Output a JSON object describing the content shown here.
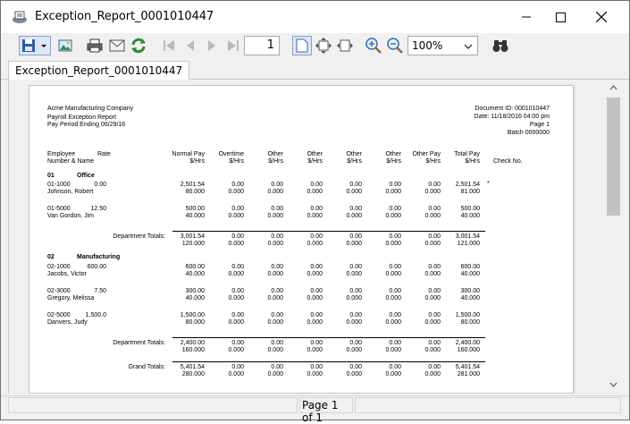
{
  "window": {
    "title": "Exception_Report_0001010447"
  },
  "toolbar": {
    "page_number": "1",
    "zoom": "100%"
  },
  "tab": {
    "label": "Exception_Report_0001010447"
  },
  "status": {
    "page_text": "Page 1 of 1"
  },
  "report": {
    "company": "Acme Manufacturing Company",
    "report_name": "Payroll Exception Report",
    "period": "Pay Period Ending 06/29/16",
    "document_id": "Document ID: 0001010447",
    "date": "Date: 11/18/2016  04:00 pm",
    "page": "Page 1",
    "batch": "Batch 0000000",
    "headers": {
      "employee": "Employee",
      "number_name": "Number & Name",
      "rate": "Rate",
      "normal_pay": "Normal Pay",
      "overtime": "Overtime",
      "other1": "Other",
      "other2": "Other",
      "other3": "Other",
      "other4": "Other",
      "other_pay": "Other Pay",
      "total_pay": "Total Pay",
      "hrs1": "$/Hrs",
      "hrs2": "$/Hrs",
      "hrs3": "$/Hrs",
      "hrs4": "$/Hrs",
      "hrs5": "$/Hrs",
      "hrs6": "$/Hrs",
      "hrs7": "$/Hrs",
      "hrs8": "$/Hrs",
      "check_no": "Check No."
    },
    "dept1": {
      "number": "01",
      "name": "Office"
    },
    "dept2": {
      "number": "02",
      "name": "Manufacturing"
    },
    "emp1": {
      "id": "01-1000",
      "rate": "0.00",
      "name": "Johnson, Robert",
      "v1": [
        "2,501.54",
        "0.00",
        "0.00",
        "0.00",
        "0.00",
        "0.00",
        "0.00",
        "2,501.54"
      ],
      "v2": [
        "80.000",
        "0.000",
        "0.000",
        "0.000",
        "0.000",
        "0.000",
        "0.000",
        "81.000"
      ],
      "flag": "*"
    },
    "emp2": {
      "id": "01-5000",
      "rate": "12.50",
      "name": "Van Gordon, Jim",
      "v1": [
        "500.00",
        "0.00",
        "0.00",
        "0.00",
        "0.00",
        "0.00",
        "0.00",
        "500.00"
      ],
      "v2": [
        "40.000",
        "0.000",
        "0.000",
        "0.000",
        "0.000",
        "0.000",
        "0.000",
        "40.000"
      ]
    },
    "dept1_totals": {
      "label": "Department Totals:",
      "v1": [
        "3,001.54",
        "0.00",
        "0.00",
        "0.00",
        "0.00",
        "0.00",
        "0.00",
        "3,001.54"
      ],
      "v2": [
        "120.000",
        "0.000",
        "0.000",
        "0.000",
        "0.000",
        "0.000",
        "0.000",
        "121.000"
      ]
    },
    "emp3": {
      "id": "02-1000",
      "rate": "600.00",
      "name": "Jacobs, Victor",
      "v1": [
        "600.00",
        "0.00",
        "0.00",
        "0.00",
        "0.00",
        "0.00",
        "0.00",
        "600.00"
      ],
      "v2": [
        "40.000",
        "0.000",
        "0.000",
        "0.000",
        "0.000",
        "0.000",
        "0.000",
        "40.000"
      ]
    },
    "emp4": {
      "id": "02-3000",
      "rate": "7.50",
      "name": "Gregory, Melissa",
      "v1": [
        "300.00",
        "0.00",
        "0.00",
        "0.00",
        "0.00",
        "0.00",
        "0.00",
        "300.00"
      ],
      "v2": [
        "40.000",
        "0.000",
        "0.000",
        "0.000",
        "0.000",
        "0.000",
        "0.000",
        "40.000"
      ]
    },
    "emp5": {
      "id": "02-5000",
      "rate": "1,500.0",
      "name": "Danvers, Judy",
      "v1": [
        "1,500.00",
        "0.00",
        "0.00",
        "0.00",
        "0.00",
        "0.00",
        "0.00",
        "1,500.00"
      ],
      "v2": [
        "80.000",
        "0.000",
        "0.000",
        "0.000",
        "0.000",
        "0.000",
        "0.000",
        "80.000"
      ]
    },
    "dept2_totals": {
      "label": "Department Totals:",
      "v1": [
        "2,400.00",
        "0.00",
        "0.00",
        "0.00",
        "0.00",
        "0.00",
        "0.00",
        "2,400.00"
      ],
      "v2": [
        "160.000",
        "0.000",
        "0.000",
        "0.000",
        "0.000",
        "0.000",
        "0.000",
        "160.000"
      ]
    },
    "grand_totals": {
      "label": "Grand Totals:",
      "v1": [
        "5,401.54",
        "0.00",
        "0.00",
        "0.00",
        "0.00",
        "0.00",
        "0.00",
        "5,401.54"
      ],
      "v2": [
        "280.000",
        "0.000",
        "0.000",
        "0.000",
        "0.000",
        "0.000",
        "0.000",
        "281.000"
      ]
    }
  }
}
